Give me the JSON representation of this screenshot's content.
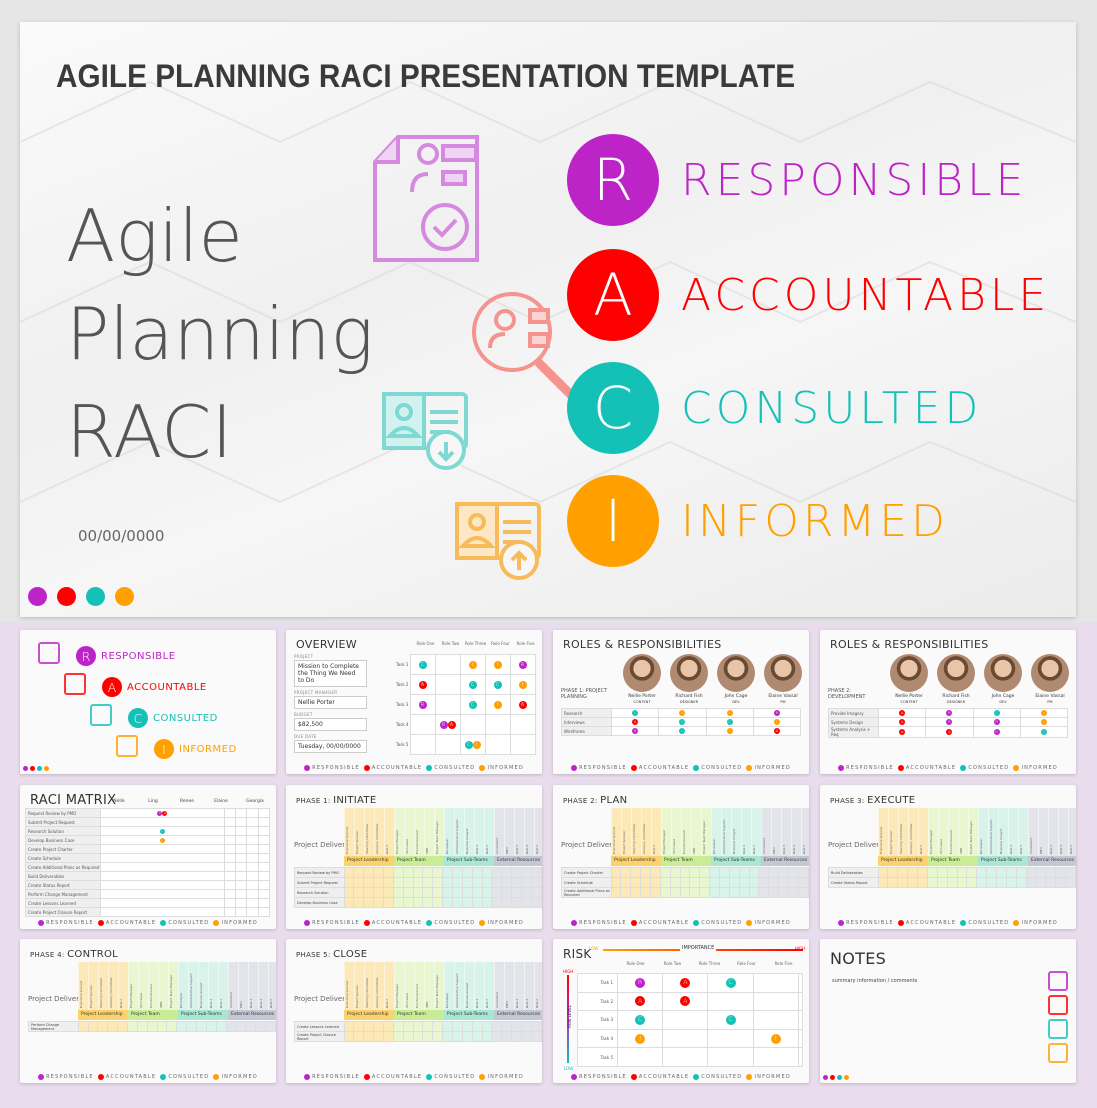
{
  "hero": {
    "header_title": "AGILE PLANNING RACI PRESENTATION TEMPLATE",
    "big_title_lines": [
      "Agile",
      "Planning",
      "RACI"
    ],
    "date": "00/00/0000",
    "raci": [
      {
        "letter": "R",
        "word": "RESPONSIBLE",
        "color": "#bd24c8",
        "icon": "document-person-check-icon"
      },
      {
        "letter": "A",
        "word": "ACCOUNTABLE",
        "color": "#ff0000",
        "icon": "magnifier-person-icon"
      },
      {
        "letter": "C",
        "word": "CONSULTED",
        "color": "#14c1b6",
        "icon": "id-card-download-icon"
      },
      {
        "letter": "I",
        "word": "INFORMED",
        "color": "#ff9f00",
        "icon": "id-card-upload-icon"
      }
    ]
  },
  "colors": {
    "R": "#bd24c8",
    "A": "#ff0000",
    "C": "#14c1b6",
    "I": "#ff9f00"
  },
  "legend": [
    "RESPONSIBLE",
    "ACCOUNTABLE",
    "CONSULTED",
    "INFORMED"
  ],
  "thumbnails": {
    "raci_cover": {
      "items": [
        "RESPONSIBLE",
        "ACCOUNTABLE",
        "CONSULTED",
        "INFORMED"
      ]
    },
    "overview": {
      "title": "OVERVIEW",
      "fields": [
        {
          "label": "PROJECT",
          "value": "Mission to Complete the Thing We Need to Do"
        },
        {
          "label": "PROJECT MANAGER",
          "value": "Nellie Porter"
        },
        {
          "label": "BUDGET",
          "value": "$82,500"
        },
        {
          "label": "DUE DATE",
          "value": "Tuesday, 00/00/0000"
        }
      ],
      "roles": [
        "Role One",
        "Role Two",
        "Role Three",
        "Role Four",
        "Role Five"
      ],
      "tasks": [
        "Task 1",
        "Task 2",
        "Task 3",
        "Task 4",
        "Task 5"
      ],
      "grid": [
        [
          "C",
          "",
          "I",
          "I",
          "R"
        ],
        [
          "A",
          "",
          "C",
          "C",
          "I"
        ],
        [
          "R",
          "",
          "C",
          "I",
          "A"
        ],
        [
          "",
          "RA",
          "",
          "",
          ""
        ],
        [
          "",
          "",
          "CI",
          "",
          ""
        ]
      ]
    },
    "roles1": {
      "title": "ROLES & RESPONSIBILITIES",
      "phase": "PHASE 1: PROJECT PLANNING",
      "people": [
        {
          "name": "Nellie Porter",
          "role": "CONTENT"
        },
        {
          "name": "Richard Fish",
          "role": "DESIGNER"
        },
        {
          "name": "John Cage",
          "role": "DEV"
        },
        {
          "name": "Elaine Vassal",
          "role": "PM"
        }
      ],
      "rows": [
        {
          "task": "Research",
          "cells": [
            "C",
            "I",
            "I",
            "R"
          ]
        },
        {
          "task": "Interviews",
          "cells": [
            "A",
            "C",
            "C",
            "I"
          ]
        },
        {
          "task": "Wireframe",
          "cells": [
            "R",
            "C",
            "I",
            "A"
          ]
        }
      ]
    },
    "roles2": {
      "title": "ROLES & RESPONSIBILITIES",
      "phase": "PHASE 2: DEVELOPMENT",
      "people": [
        {
          "name": "Nellie Porter",
          "role": "CONTENT"
        },
        {
          "name": "Richard Fish",
          "role": "DESIGNER"
        },
        {
          "name": "John Cage",
          "role": "DEV"
        },
        {
          "name": "Elaine Vassal",
          "role": "PM"
        }
      ],
      "rows": [
        {
          "task": "Provide Imagery",
          "cells": [
            "A",
            "R",
            "C",
            "I"
          ]
        },
        {
          "task": "Systems Design",
          "cells": [
            "A",
            "R",
            "R",
            "I"
          ]
        },
        {
          "task": "Systems Analysis + Req",
          "cells": [
            "A",
            "A",
            "R",
            "C"
          ]
        }
      ]
    },
    "matrix": {
      "title": "RACI MATRIX",
      "people": [
        "Nelle",
        "Ling",
        "Renee",
        "Elaine",
        "Georgia"
      ],
      "tasks": [
        "Request Review by PMO",
        "Submit Project Request",
        "Research Solution",
        "Develop Business Case",
        "Create Project Charter",
        "Create Schedule",
        "Create Additional Plans as Required",
        "Build Deliverables",
        "Create Status Report",
        "Perform Change Management",
        "Create Lessons Learned",
        "Create Project Closure Report"
      ],
      "marks": [
        [
          "RA",
          "",
          "",
          "",
          ""
        ],
        [
          "",
          "",
          "",
          "",
          ""
        ],
        [
          "C",
          "",
          "",
          "",
          ""
        ],
        [
          "I",
          "",
          "",
          "",
          ""
        ]
      ]
    },
    "phases": [
      {
        "prefix": "PHASE 1:",
        "name": "INITIATE",
        "rows": [
          "Request Review by PMO",
          "Submit Project Request",
          "Research Solution",
          "Develop Business Case"
        ]
      },
      {
        "prefix": "PHASE 2:",
        "name": "PLAN",
        "rows": [
          "Create Project Charter",
          "Create Schedule",
          "Create Additional Plans as Required"
        ]
      },
      {
        "prefix": "PHASE 3:",
        "name": "EXECUTE",
        "rows": [
          "Build Deliverables",
          "Create Status Report"
        ]
      },
      {
        "prefix": "PHASE 4:",
        "name": "CONTROL",
        "rows": [
          "Perform Change Management"
        ]
      },
      {
        "prefix": "PHASE 5:",
        "name": "CLOSE",
        "rows": [
          "Create Lessons Learned",
          "Create Project Closure Report"
        ]
      }
    ],
    "phase_common": {
      "deliverable_label": "Project Deliverable or Activity",
      "groups": [
        "Project Leadership",
        "Project Team Members",
        "Project Sub-Teams",
        "External Resources"
      ],
      "columns": [
        "Executive Sponsor",
        "Project Sponsor",
        "Steering Committee",
        "Advisory Committee",
        "Role 5",
        "Project Manager",
        "Tech Lead",
        "Functional Lead",
        "SME",
        "Project Team Manager",
        "Developer",
        "Administrative Support",
        "Business Analyst",
        "Role 4",
        "Role 5",
        "Consultant",
        "PMO",
        "Role 3",
        "Role 4",
        "Role 5"
      ]
    },
    "risk": {
      "title": "RISK",
      "x_axis": "IMPORTANCE",
      "x_low": "LOW",
      "x_high": "HIGH",
      "y_axis": "RISK LEVEL",
      "y_low": "LOW",
      "y_high": "HIGH",
      "roles": [
        "Role One",
        "Role Two",
        "Role Three",
        "Role Four",
        "Role Five"
      ],
      "tasks": [
        "Task 1",
        "Task 2",
        "Task 3",
        "Task 4",
        "Task 5"
      ],
      "grid": [
        [
          "R",
          "A",
          "C",
          "",
          ""
        ],
        [
          "A",
          "A",
          "",
          "",
          ""
        ],
        [
          "C",
          "",
          "C",
          "",
          ""
        ],
        [
          "I",
          "",
          "",
          "I",
          ""
        ],
        [
          "",
          "",
          "",
          "",
          ""
        ]
      ]
    },
    "notes": {
      "title": "NOTES",
      "text": "summary information / comments"
    }
  }
}
